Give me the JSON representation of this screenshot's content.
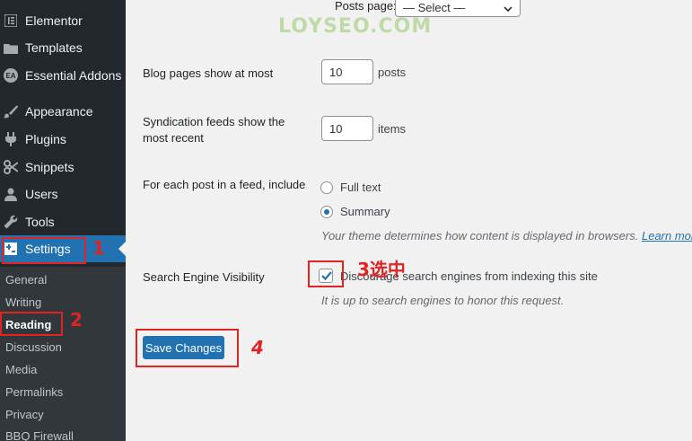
{
  "sidebar": {
    "menu": [
      {
        "label": "Elementor",
        "icon": "elementor-icon"
      },
      {
        "label": "Templates",
        "icon": "folder-icon"
      },
      {
        "label": "Essential Addons",
        "icon": "ea-icon",
        "badge": "EA"
      },
      {
        "label": "Appearance",
        "icon": "brush-icon"
      },
      {
        "label": "Plugins",
        "icon": "plug-icon"
      },
      {
        "label": "Snippets",
        "icon": "scissors-icon"
      },
      {
        "label": "Users",
        "icon": "user-icon"
      },
      {
        "label": "Tools",
        "icon": "wrench-icon"
      },
      {
        "label": "Settings",
        "icon": "settings-icon",
        "active": true
      }
    ],
    "submenu": [
      {
        "label": "General"
      },
      {
        "label": "Writing"
      },
      {
        "label": "Reading",
        "current": true
      },
      {
        "label": "Discussion"
      },
      {
        "label": "Media"
      },
      {
        "label": "Permalinks"
      },
      {
        "label": "Privacy"
      },
      {
        "label": "BBQ Firewall"
      }
    ]
  },
  "settings": {
    "posts_page_label": "Posts page:",
    "posts_page_value": "— Select —",
    "blog_pages_label": "Blog pages show at most",
    "blog_pages_value": "10",
    "blog_pages_unit": "posts",
    "feeds_label_line1": "Syndication feeds show the",
    "feeds_label_line2": "most recent",
    "feeds_value": "10",
    "feeds_unit": "items",
    "feed_include_label": "For each post in a feed, include",
    "feed_options": [
      {
        "label": "Full text",
        "selected": false
      },
      {
        "label": "Summary",
        "selected": true
      }
    ],
    "feed_desc": "Your theme determines how content is displayed in browsers.",
    "feed_desc_link": "Learn more abo",
    "sev_label": "Search Engine Visibility",
    "sev_checkbox_label": "Discourage search engines from indexing this site",
    "sev_checked": true,
    "sev_desc": "It is up to search engines to honor this request.",
    "save_label": "Save Changes"
  },
  "annotations": {
    "n1": "1",
    "n2": "2",
    "n3": "3选中",
    "n4": "4"
  },
  "watermark": "LOYSEO.COM",
  "colors": {
    "accent": "#2271b1",
    "sidebar": "#23282d",
    "annotation": "#e02424"
  }
}
